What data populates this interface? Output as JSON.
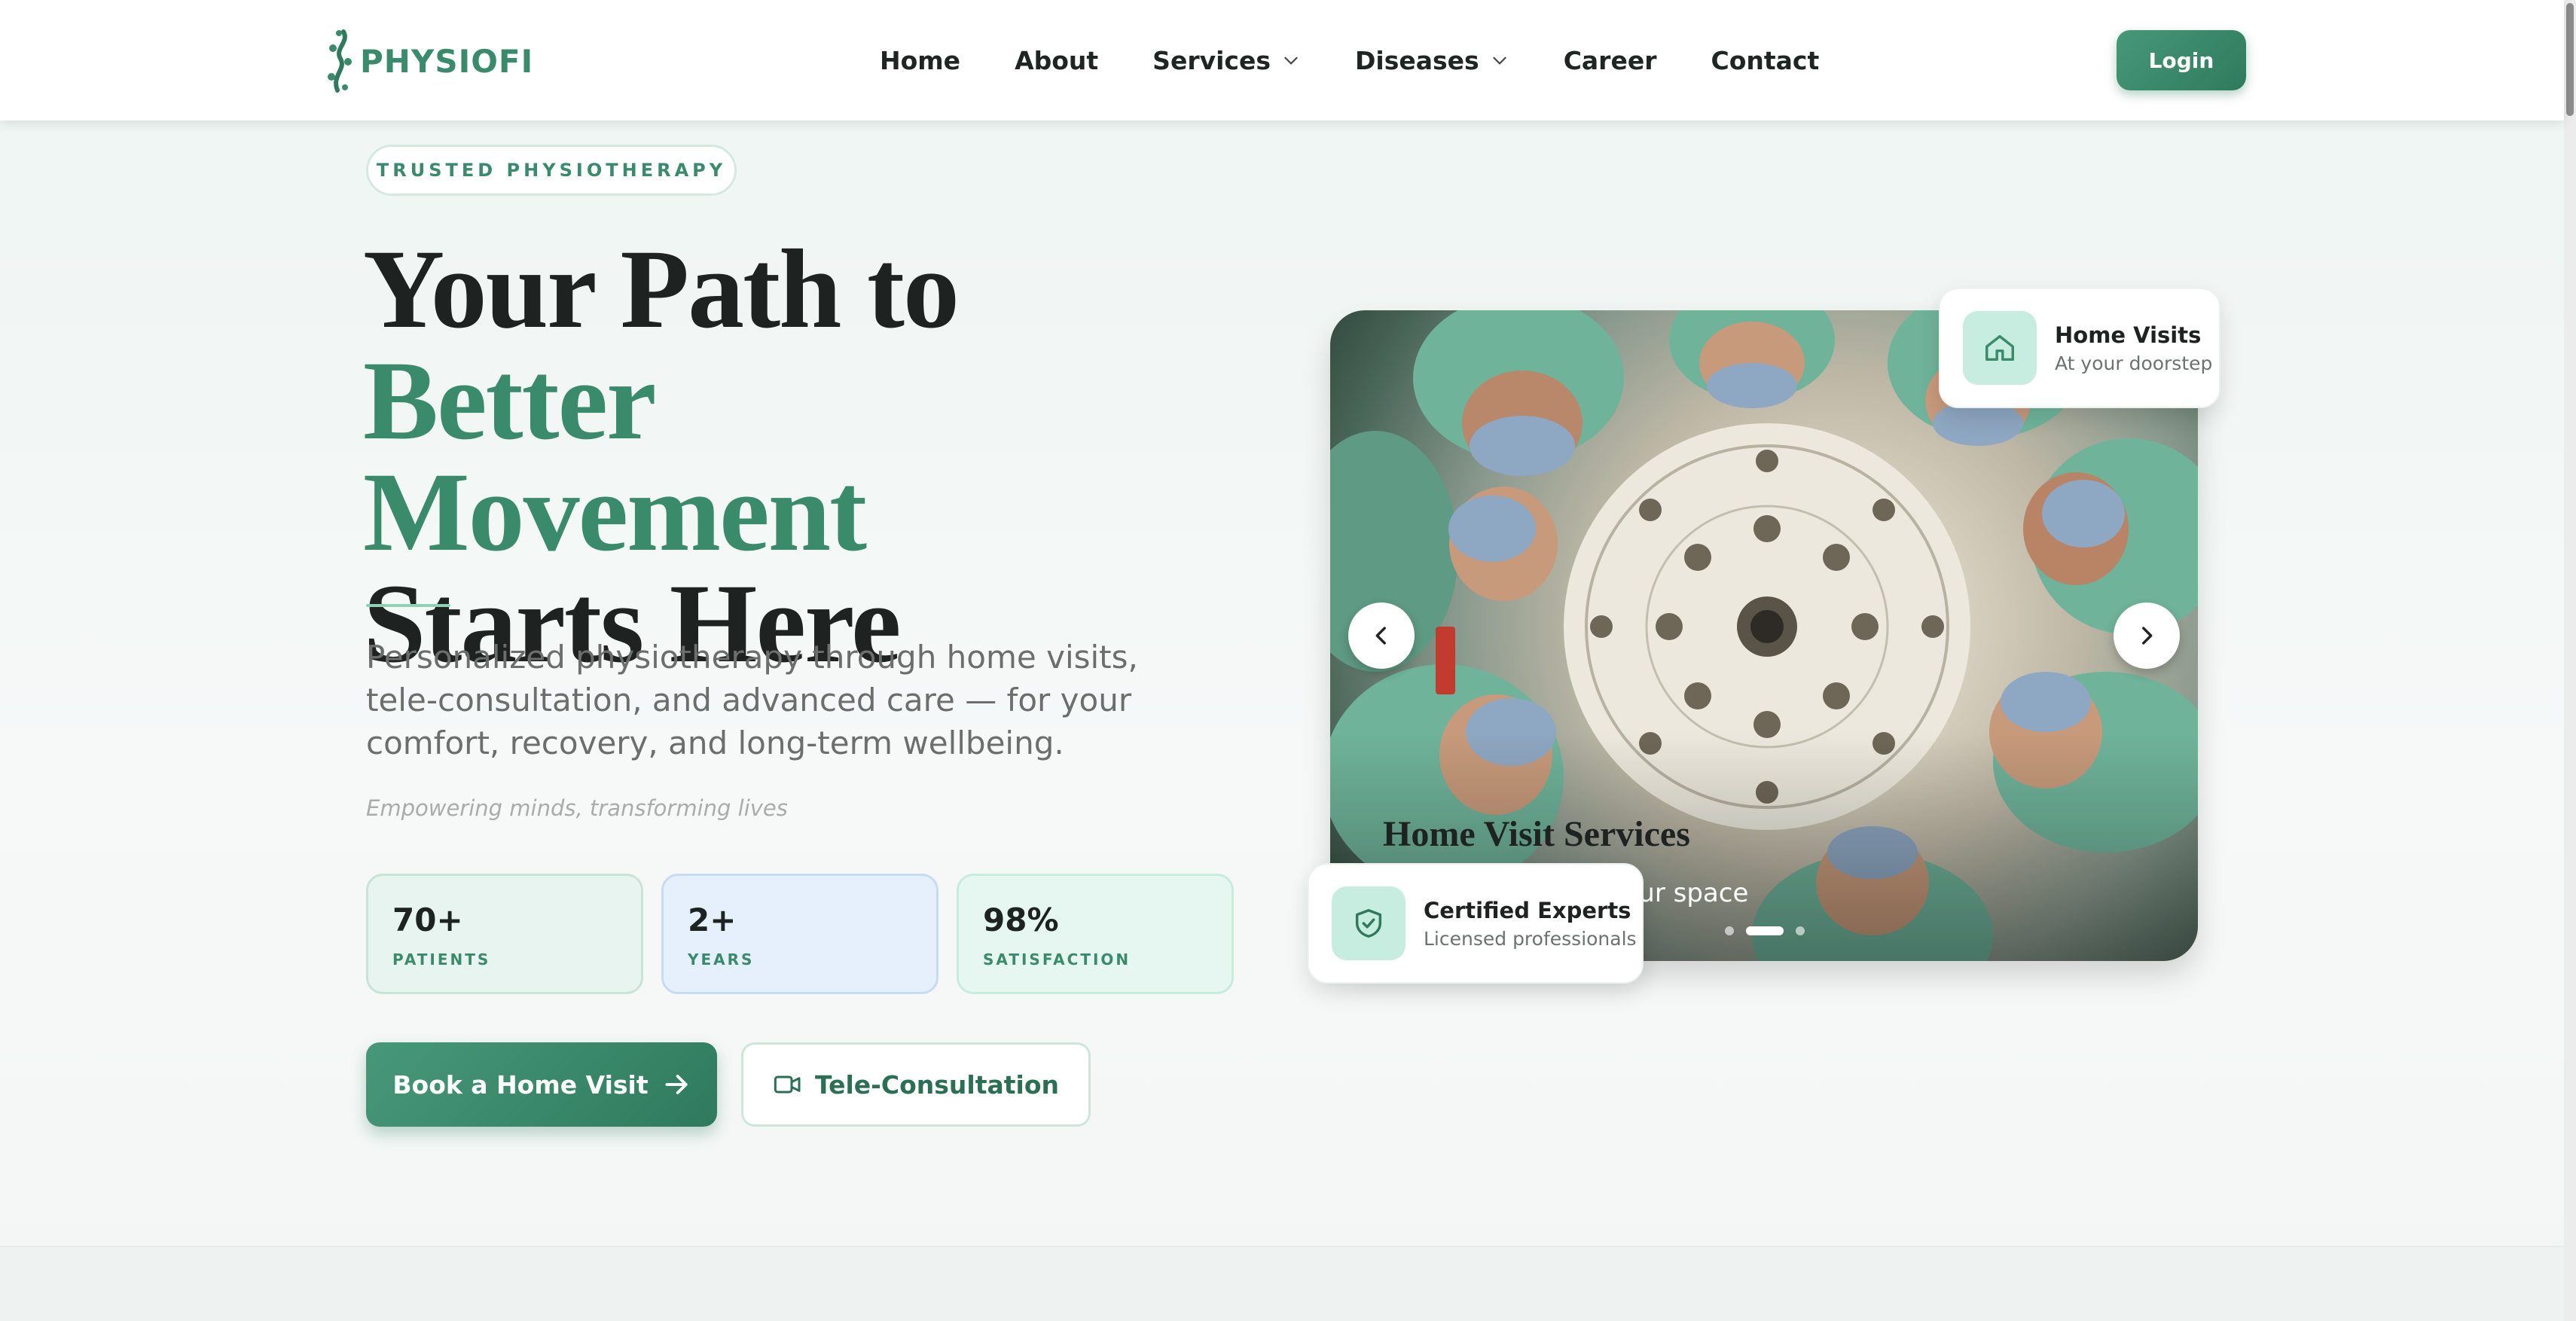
{
  "brand": {
    "name": "PHYSIOFI",
    "accent": "#3a8a6c"
  },
  "nav": {
    "items": [
      {
        "label": "Home",
        "dropdown": false
      },
      {
        "label": "About",
        "dropdown": false
      },
      {
        "label": "Services",
        "dropdown": true
      },
      {
        "label": "Diseases",
        "dropdown": true
      },
      {
        "label": "Career",
        "dropdown": false
      },
      {
        "label": "Contact",
        "dropdown": false
      }
    ],
    "login_label": "Login"
  },
  "hero": {
    "badge": "TRUSTED PHYSIOTHERAPY",
    "headline_line1_plain": "Your Path to ",
    "headline_line1_accent": "Better",
    "headline_line2_accent": "Movement",
    "headline_line3": "Starts Here",
    "lead": "Personalized physiotherapy through home visits, tele-consultation, and advanced care — for your comfort, recovery, and long-term wellbeing.",
    "tagline": "Empowering minds, transforming lives",
    "stats": [
      {
        "value": "70+",
        "label": "PATIENTS"
      },
      {
        "value": "2+",
        "label": "YEARS"
      },
      {
        "value": "98%",
        "label": "SATISFACTION"
      }
    ],
    "primary_cta": "Book a Home Visit",
    "secondary_cta": "Tele-Consultation"
  },
  "carousel": {
    "slide_title": "Home Visit Services",
    "slide_subtitle": "n your space",
    "active_dot": 1,
    "dot_count": 3
  },
  "cards": {
    "home_visits": {
      "title": "Home Visits",
      "subtitle": "At your doorstep",
      "icon": "home-icon"
    },
    "certified": {
      "title": "Certified Experts",
      "subtitle": "Licensed professionals",
      "icon": "shield-check-icon"
    }
  }
}
